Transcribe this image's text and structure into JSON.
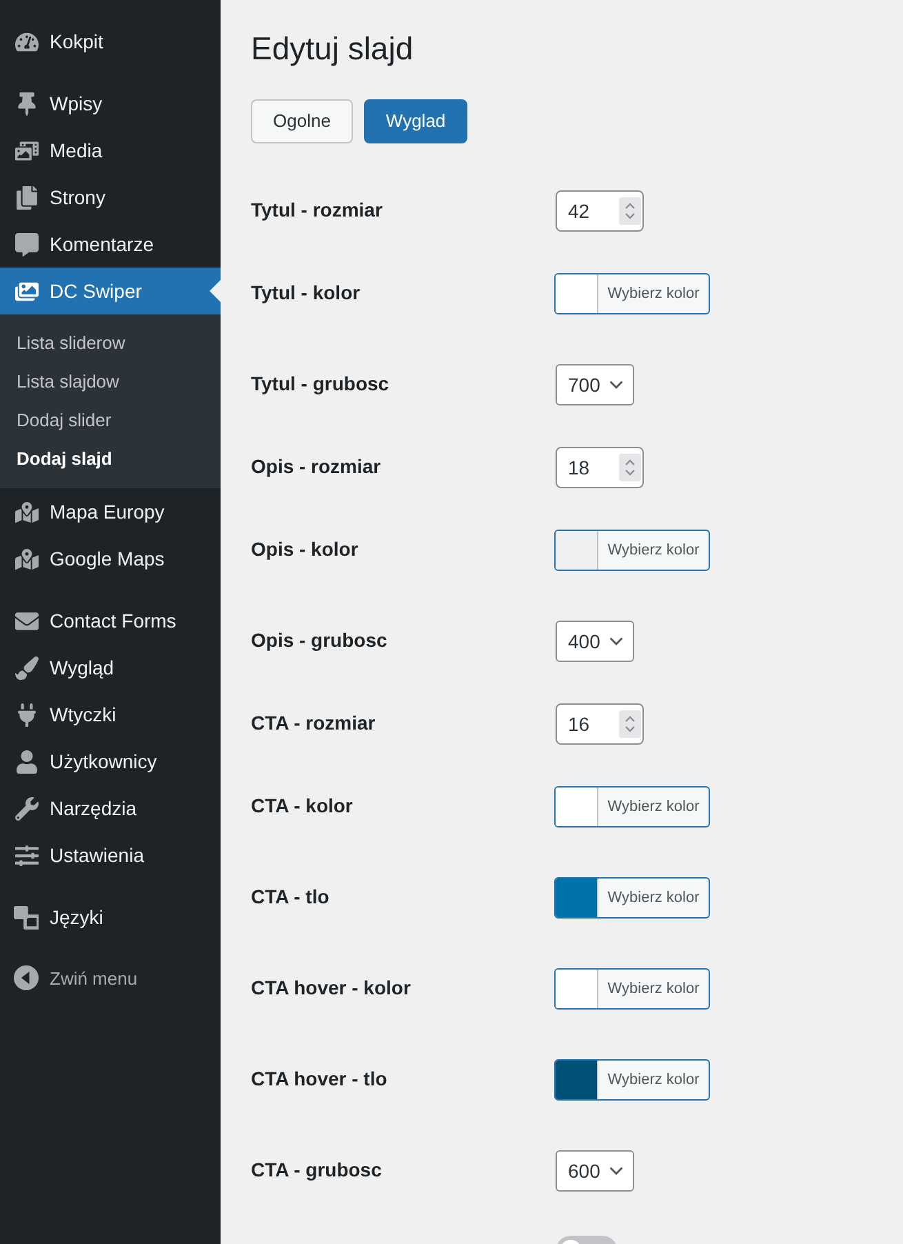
{
  "sidebar": {
    "groups": [
      {
        "items": [
          {
            "label": "Kokpit",
            "selected": false
          }
        ]
      },
      {
        "items": [
          {
            "label": "Wpisy",
            "selected": false
          },
          {
            "label": "Media",
            "selected": false
          },
          {
            "label": "Strony",
            "selected": false
          },
          {
            "label": "Komentarze",
            "selected": false
          },
          {
            "label": "DC Swiper",
            "selected": true,
            "children": [
              {
                "label": "Lista sliderow",
                "selected": false
              },
              {
                "label": "Lista slajdow",
                "selected": false
              },
              {
                "label": "Dodaj slider",
                "selected": false
              },
              {
                "label": "Dodaj slajd",
                "selected": true
              }
            ]
          },
          {
            "label": "Mapa Europy",
            "selected": false
          },
          {
            "label": "Google Maps",
            "selected": false
          }
        ]
      },
      {
        "items": [
          {
            "label": "Contact Forms",
            "selected": false
          },
          {
            "label": "Wygląd",
            "selected": false
          },
          {
            "label": "Wtyczki",
            "selected": false
          },
          {
            "label": "Użytkownicy",
            "selected": false
          },
          {
            "label": "Narzędzia",
            "selected": false
          },
          {
            "label": "Ustawienia",
            "selected": false
          }
        ]
      },
      {
        "items": [
          {
            "label": "Języki",
            "selected": false
          }
        ]
      }
    ],
    "collapse": {
      "label": "Zwiń menu"
    }
  },
  "page": {
    "title": "Edytuj slajd",
    "tabs": [
      {
        "label": "Ogolne",
        "selected": false
      },
      {
        "label": "Wyglad",
        "selected": true
      }
    ]
  },
  "fields": [
    {
      "kind": "number",
      "label": "Tytul - rozmiar",
      "value": "42"
    },
    {
      "kind": "color",
      "label": "Tytul - kolor",
      "color": "#ffffff",
      "button": "Wybierz kolor"
    },
    {
      "kind": "select",
      "label": "Tytul - grubosc",
      "value": "700"
    },
    {
      "kind": "number",
      "label": "Opis - rozmiar",
      "value": "18"
    },
    {
      "kind": "color",
      "label": "Opis - kolor",
      "color": "#f0f0f0",
      "button": "Wybierz kolor"
    },
    {
      "kind": "select",
      "label": "Opis - grubosc",
      "value": "400"
    },
    {
      "kind": "number",
      "label": "CTA - rozmiar",
      "value": "16"
    },
    {
      "kind": "color",
      "label": "CTA - kolor",
      "color": "#ffffff",
      "button": "Wybierz kolor"
    },
    {
      "kind": "color",
      "label": "CTA - tlo",
      "color": "#0073aa",
      "button": "Wybierz kolor"
    },
    {
      "kind": "color",
      "label": "CTA hover - kolor",
      "color": "#ffffff",
      "button": "Wybierz kolor"
    },
    {
      "kind": "color",
      "label": "CTA hover - tlo",
      "color": "#005177",
      "button": "Wybierz kolor"
    },
    {
      "kind": "select",
      "label": "CTA - grubosc",
      "value": "600"
    },
    {
      "kind": "toggle",
      "on": false
    }
  ]
}
